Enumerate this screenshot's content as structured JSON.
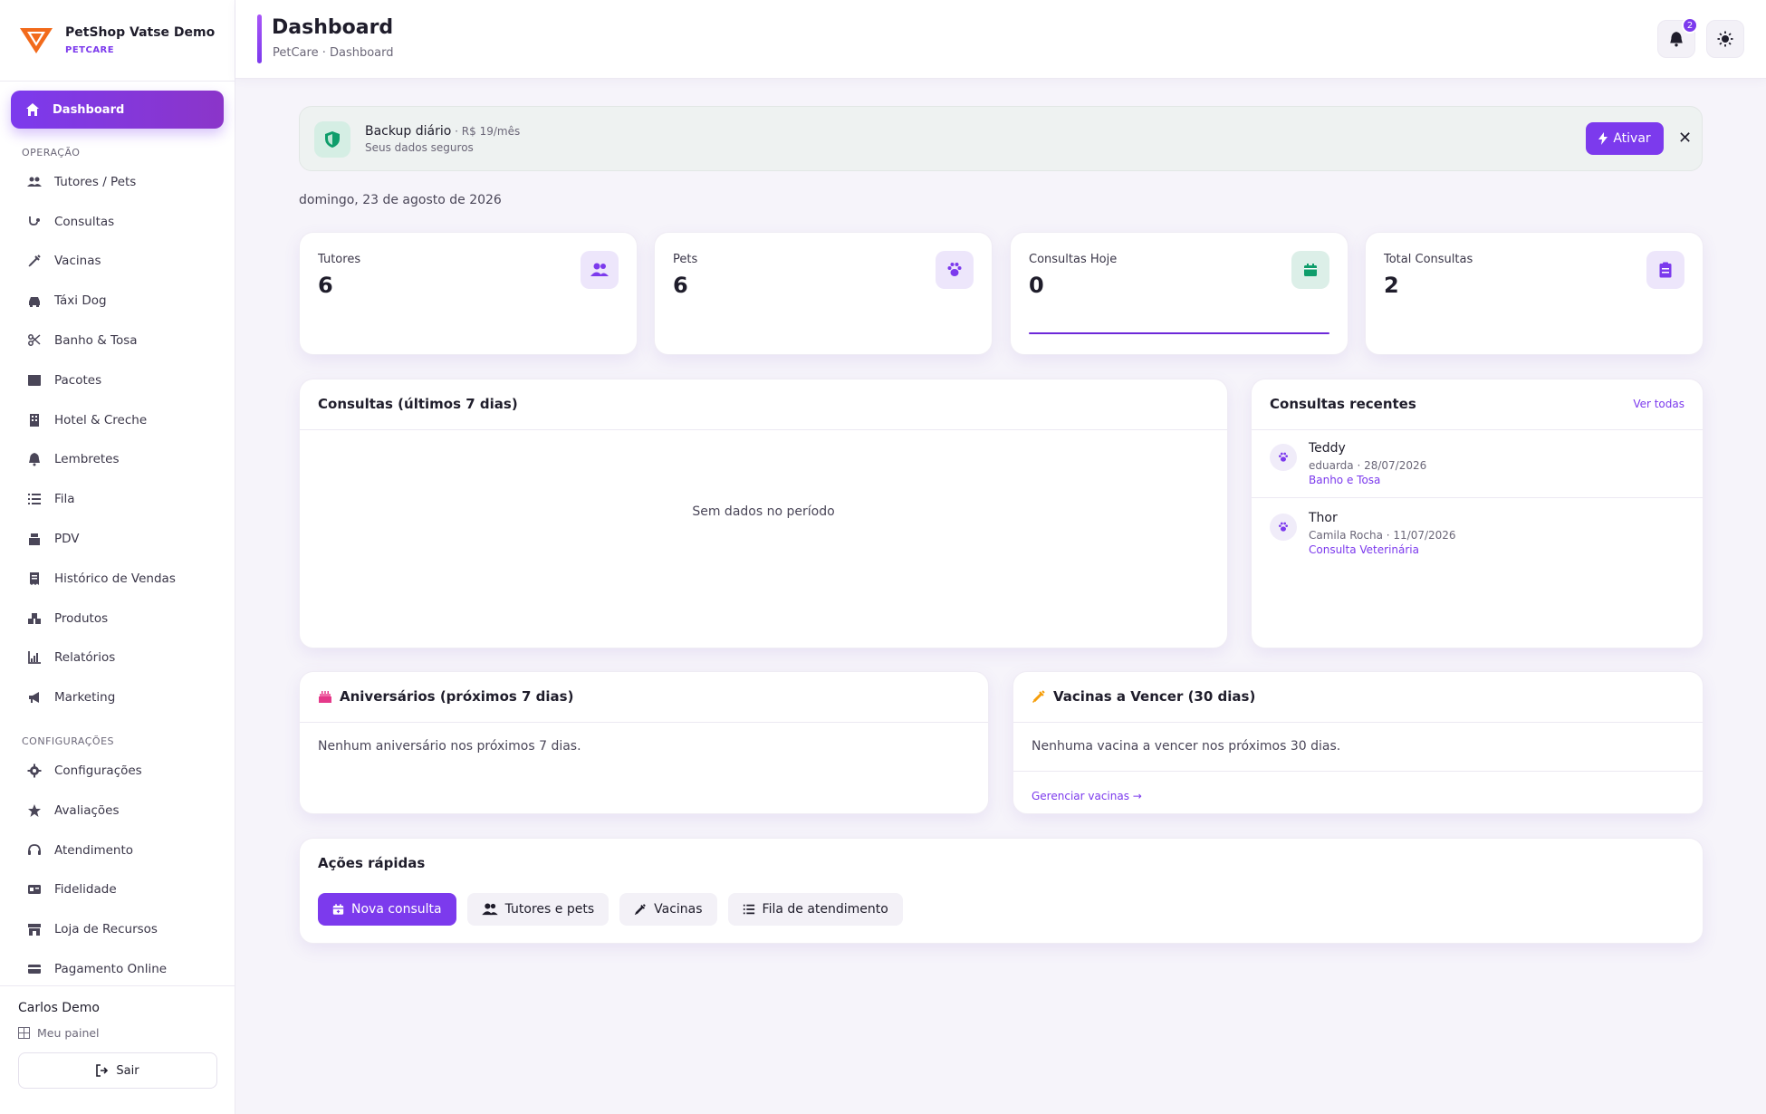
{
  "brand": {
    "name": "PetShop Vatse Demo",
    "subtitle": "PETCARE"
  },
  "nav": {
    "active": "Dashboard",
    "section_operation": "OPERAÇÃO",
    "operation_items": [
      "Tutores / Pets",
      "Consultas",
      "Vacinas",
      "Táxi Dog",
      "Banho & Tosa",
      "Pacotes",
      "Hotel & Creche",
      "Lembretes",
      "Fila",
      "PDV",
      "Histórico de Vendas",
      "Produtos",
      "Relatórios",
      "Marketing"
    ],
    "section_config": "CONFIGURAÇÕES",
    "config_items": [
      "Configurações",
      "Avaliações",
      "Atendimento",
      "Fidelidade",
      "Loja de Recursos",
      "Pagamento Online"
    ]
  },
  "user": {
    "name": "Carlos Demo",
    "panel": "Meu painel",
    "logout": "Sair"
  },
  "header": {
    "title": "Dashboard",
    "breadcrumb": "PetCare · Dashboard",
    "notifications": "2"
  },
  "banner": {
    "title": "Backup diário",
    "price": " · R$ 19/mês",
    "subtitle": "Seus dados seguros",
    "action": "Ativar",
    "close": "✕"
  },
  "date": "domingo, 23 de agosto de 2026",
  "stats": [
    {
      "label": "Tutores",
      "value": "6"
    },
    {
      "label": "Pets",
      "value": "6"
    },
    {
      "label": "Consultas Hoje",
      "value": "0"
    },
    {
      "label": "Total Consultas",
      "value": "2"
    }
  ],
  "chart_card": {
    "title": "Consultas (últimos 7 dias)",
    "empty": "Sem dados no período"
  },
  "recent": {
    "title": "Consultas recentes",
    "see_all": "Ver todas",
    "items": [
      {
        "name": "Teddy",
        "meta": "eduarda · 28/07/2026",
        "service": "Banho e Tosa"
      },
      {
        "name": "Thor",
        "meta": "Camila Rocha · 11/07/2026",
        "service": "Consulta Veterinária"
      }
    ]
  },
  "birthdays": {
    "title": "Aniversários (próximos 7 dias)",
    "empty": "Nenhum aniversário nos próximos 7 dias."
  },
  "vaccines": {
    "title": "Vacinas a Vencer (30 dias)",
    "empty": "Nenhuma vacina a vencer nos próximos 30 dias.",
    "link": "Gerenciar vacinas →"
  },
  "quick": {
    "title": "Ações rápidas",
    "actions": [
      "Nova consulta",
      "Tutores e pets",
      "Vacinas",
      "Fila de atendimento"
    ]
  },
  "colors": {
    "accent": "#7c3aed",
    "success": "#0f9d6b",
    "brand_orange": "#f26a1b"
  }
}
